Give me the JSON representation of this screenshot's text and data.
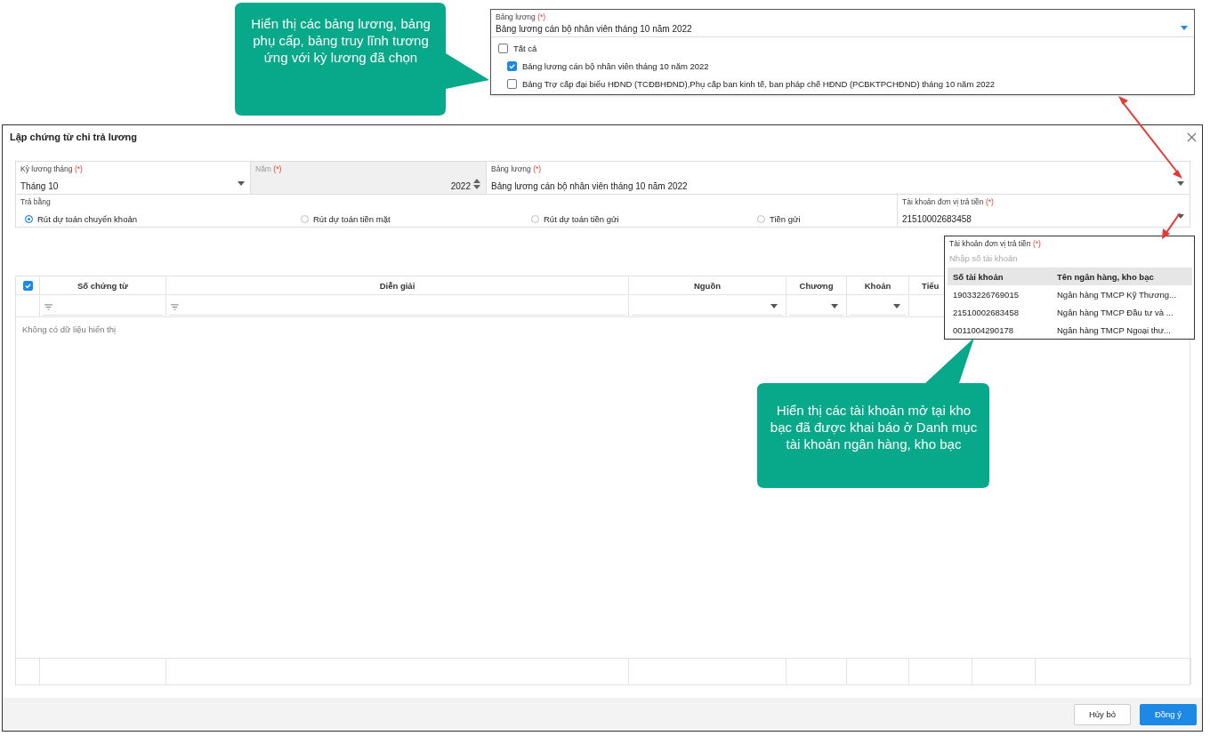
{
  "callouts": [
    {
      "text": "Hiển thị các bảng lương, bảng phụ cấp, bảng truy lĩnh tương ứng với kỳ lương đã chọn"
    },
    {
      "text": "Hiển thị các tài khoản mở tại kho bạc đã được khai báo ở Danh mục tài khoản ngân hàng, kho bạc"
    }
  ],
  "salary_table_popup": {
    "label": "Bảng lương",
    "required_mark": "(*)",
    "value": "Bảng lương cán bộ nhân viên tháng 10 năm 2022",
    "options": [
      {
        "label": "Tất cả",
        "checked": false,
        "children": [
          {
            "label": "Bảng lương cán bộ nhân viên tháng 10 năm 2022",
            "checked": true
          },
          {
            "label": "Bảng Trợ cấp đại biểu HĐND (TCĐBHĐND),Phụ cấp ban kinh tế, ban pháp chế HĐND (PCBKTPCHĐND) tháng 10 năm 2022",
            "checked": false
          }
        ]
      }
    ]
  },
  "dialog": {
    "title": "Lập chứng từ chi trả lương",
    "fields": [
      {
        "kind": "select",
        "label": "Kỳ lương tháng",
        "required_mark": "(*)",
        "value": "Tháng 10",
        "disabled": false
      },
      {
        "kind": "number",
        "label": "Năm",
        "required_mark": "(*)",
        "value": "2022",
        "disabled": true
      },
      {
        "kind": "select",
        "label": "Bảng lương",
        "required_mark": "(*)",
        "value": "Bảng lương cán bộ nhân viên tháng 10 năm 2022",
        "disabled": false
      }
    ],
    "payment_method": {
      "label": "Trả bằng",
      "options": [
        {
          "label": "Rút dự toán chuyển khoản",
          "selected": true
        },
        {
          "label": "Rút dự toán tiền mặt",
          "selected": false
        },
        {
          "label": "Rút dự toán tiền gửi",
          "selected": false
        },
        {
          "label": "Tiền gửi",
          "selected": false
        }
      ]
    },
    "account_field": {
      "label": "Tài khoản đơn vị trả tiền",
      "required_mark": "(*)",
      "value": "21510002683458"
    },
    "table": {
      "select_all_checked": true,
      "columns": [
        {
          "label": "Số chứng từ",
          "kind": "text"
        },
        {
          "label": "Diễn giải",
          "kind": "text"
        },
        {
          "label": "Nguồn",
          "kind": "select"
        },
        {
          "label": "Chương",
          "kind": "select"
        },
        {
          "label": "Khoản",
          "kind": "select"
        },
        {
          "label": "Tiểu",
          "kind": "plain"
        }
      ],
      "empty_text": "Không có dữ liệu hiển thị"
    },
    "buttons": [
      {
        "label": "Hủy bỏ",
        "kind": "secondary"
      },
      {
        "label": "Đồng ý",
        "kind": "primary"
      }
    ]
  },
  "account_popup": {
    "label": "Tài khoản đơn vị trả tiền",
    "required_mark": "(*)",
    "placeholder": "Nhập số tài khoản",
    "columns": [
      "Số tài khoản",
      "Tên ngân hàng, kho bạc"
    ],
    "rows": [
      [
        "19033226769015",
        "Ngân hàng TMCP Kỹ Thương..."
      ],
      [
        "21510002683458",
        "Ngân hàng TMCP Đầu tư và ..."
      ],
      [
        "0011004290178",
        "Ngân hàng TMCP Ngoại thư..."
      ]
    ]
  }
}
